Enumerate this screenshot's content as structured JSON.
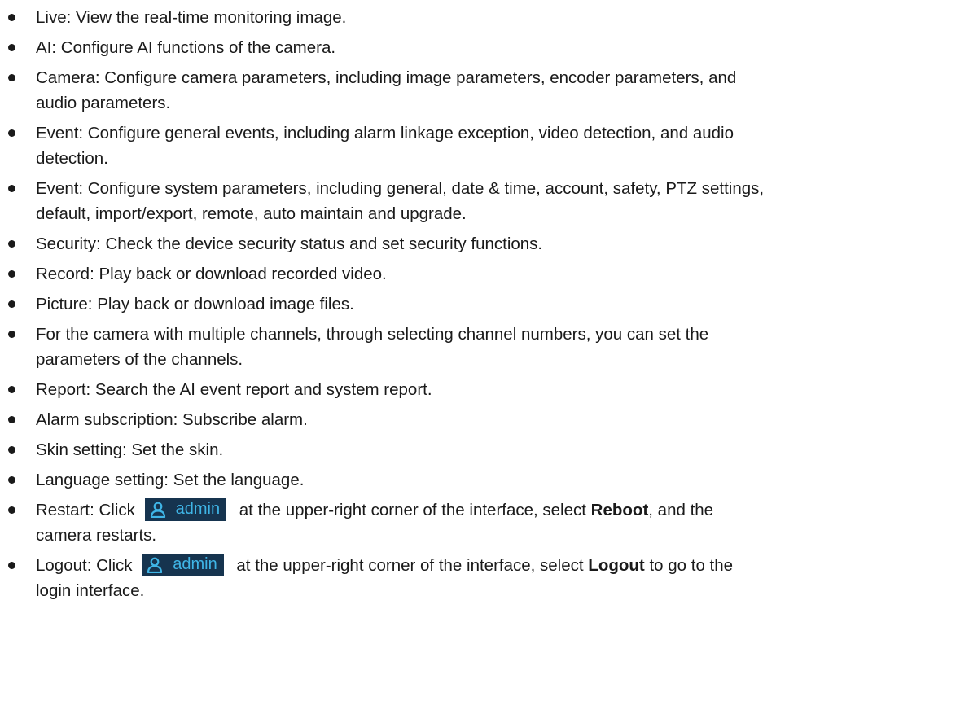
{
  "items": [
    {
      "text": "Live: View the real-time monitoring image."
    },
    {
      "text": "AI: Configure AI functions of the camera."
    },
    {
      "line1": "Camera: Configure camera parameters, including image parameters, encoder parameters, and",
      "line2": "audio parameters."
    },
    {
      "line1": "Event: Configure general events, including alarm linkage exception, video detection, and audio",
      "line2": "detection."
    },
    {
      "line1": "Event: Configure system parameters, including general, date & time, account, safety, PTZ settings,",
      "line2": "default, import/export, remote, auto maintain and upgrade."
    },
    {
      "text": "Security: Check the device security status and set security functions."
    },
    {
      "text": "Record: Play back or download recorded video."
    },
    {
      "text": "Picture: Play back or download image files."
    },
    {
      "line1": "For the camera with multiple channels, through selecting channel numbers, you can set the",
      "line2": "parameters of the channels."
    },
    {
      "text": "Report: Search the AI event report and system report."
    },
    {
      "text": "Alarm subscription: Subscribe alarm."
    },
    {
      "text": "Skin setting: Set the skin."
    },
    {
      "text": "Language setting: Set the language."
    }
  ],
  "restart": {
    "prefix": "Restart: Click",
    "chip_label": "admin",
    "middle": "at the upper-right corner of the interface, select",
    "bold": "Reboot",
    "suffix": ", and the",
    "line2": "camera restarts."
  },
  "logout": {
    "prefix": "Logout: Click",
    "chip_label": "admin",
    "middle": "at the upper-right corner of the interface, select",
    "bold": "Logout",
    "suffix": "to go to the",
    "line2": "login interface."
  },
  "chip_icon": "user-icon",
  "colors": {
    "chip_bg": "#16344f",
    "chip_fg": "#3fb5e6"
  }
}
